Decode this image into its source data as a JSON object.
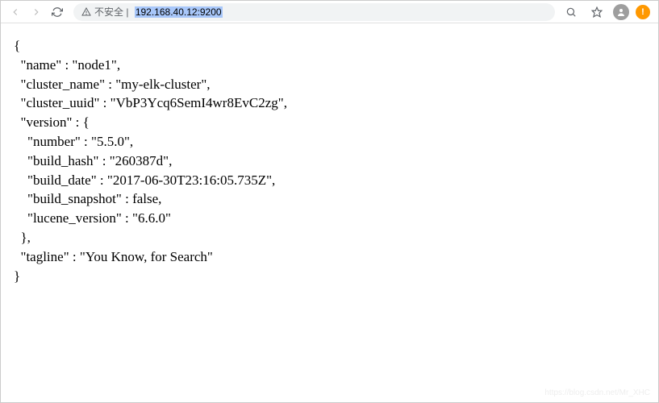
{
  "toolbar": {
    "security_label": "不安全",
    "url": "192.168.40.12:9200"
  },
  "response": {
    "name": "node1",
    "cluster_name": "my-elk-cluster",
    "cluster_uuid": "VbP3Ycq6SemI4wr8EvC2zg",
    "version": {
      "number": "5.5.0",
      "build_hash": "260387d",
      "build_date": "2017-06-30T23:16:05.735Z",
      "build_snapshot": "false",
      "lucene_version": "6.6.0"
    },
    "tagline": "You Know, for Search"
  },
  "watermark": "https://blog.csdn.net/Mr_XHC"
}
